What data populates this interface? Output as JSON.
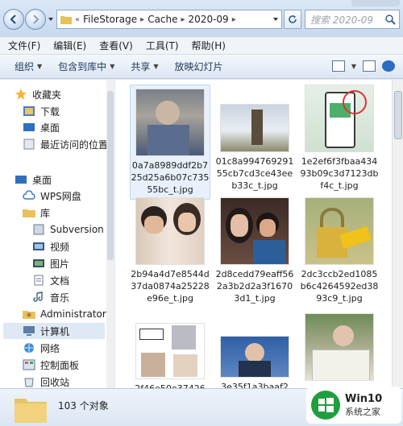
{
  "address": {
    "crumbs": [
      "FileStorage",
      "Cache",
      "2020-09"
    ],
    "overflow": "«",
    "search_placeholder": "搜索 2020-09"
  },
  "menu": [
    "文件(F)",
    "编辑(E)",
    "查看(V)",
    "工具(T)",
    "帮助(H)"
  ],
  "commands": [
    "组织",
    "包含到库中",
    "共享",
    "放映幻灯片"
  ],
  "nav": {
    "favorites": "收藏夹",
    "downloads": "下载",
    "desktop1": "桌面",
    "recent": "最近访问的位置",
    "desktop2": "桌面",
    "wps": "WPS网盘",
    "library": "库",
    "subversion": "Subversion",
    "video": "视频",
    "pictures": "图片",
    "docs": "文档",
    "music": "音乐",
    "admin": "Administrator",
    "computer": "计算机",
    "network": "网络",
    "control": "控制面板",
    "recycle": "回收站"
  },
  "files": [
    {
      "name": "0a7a8989ddf2b725d25a6b07c73555bc_t.jpg",
      "highlighted": true
    },
    {
      "name": "01c8a99476929155cb7cd3ce43eeb33c_t.jpg",
      "highlighted": false
    },
    {
      "name": "1e2ef6f3fbaa43493b09c3d7123dbf4c_t.jpg",
      "highlighted": false
    },
    {
      "name": "2b94a4d7e8544d37da0874a25228e96e_t.jpg",
      "highlighted": false
    },
    {
      "name": "2d8cedd79eaff562a3b2d2a3f16703d1_t.jpg",
      "highlighted": false
    },
    {
      "name": "2dc3ccb2ed1085b6c4264592ed3893c9_t.jpg",
      "highlighted": false
    },
    {
      "name": "2f46e50e37426",
      "highlighted": false
    },
    {
      "name": "3e35f1a3baaf2",
      "highlighted": false
    },
    {
      "name": "",
      "highlighted": false
    }
  ],
  "status": {
    "count": "103 个对象"
  },
  "watermark": {
    "line1": "Win10",
    "line2": "系统之家"
  },
  "colors": {
    "accent": "#1e395b",
    "selection": "#dfe9f5",
    "brand_green": "#1e9e3f"
  }
}
